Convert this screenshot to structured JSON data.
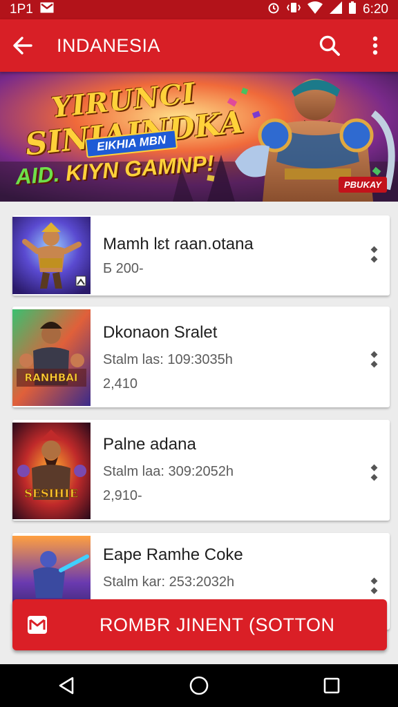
{
  "status_bar": {
    "left_text": "1P1",
    "time": "6:20"
  },
  "app_bar": {
    "title": "INDANESIA"
  },
  "banner": {
    "line1": "YIRUNCI",
    "line2": "SINIAINDKA",
    "pill": "EIKHIA MBN",
    "line3_green": "AID.",
    "line3_yellow": "KIYN GAMNP!",
    "badge": "PBUKAY"
  },
  "games": [
    {
      "name": "Mamh lɛt ɾaan.otana",
      "meta": "Б 200-",
      "count": ""
    },
    {
      "name": "Dkonaon Sralet",
      "meta": "Stalm las: 109:3035h",
      "count": "2,410"
    },
    {
      "name": "Palne adana",
      "meta": "Stalm laa: 309:2052h",
      "count": "2,910-"
    },
    {
      "name": "Eape Ramhe Coke",
      "meta": "Stalm kar: 253:2032h",
      "count": ""
    }
  ],
  "thumb_captions": [
    "",
    "RANHBAI",
    "SESIHIE"
  ],
  "action_button": {
    "label": "ROMBR JINENT (SOTTON"
  },
  "colors": {
    "primary": "#d81f26",
    "status_bar": "#b3131a",
    "background": "#ececec"
  }
}
